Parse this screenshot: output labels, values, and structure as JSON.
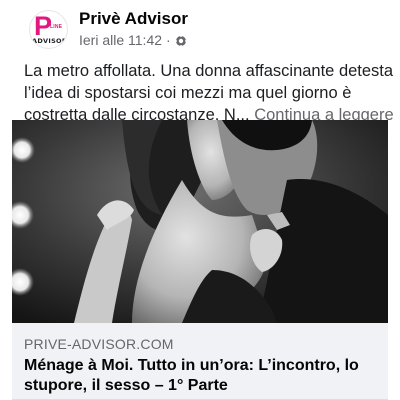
{
  "post": {
    "page_name": "Privè Advisor",
    "timestamp": "Ieri alle 11:42",
    "separator": "·",
    "audience_icon": "globe-icon",
    "text": "La metro affollata. Una donna affascinante detesta l’idea di spostarsi coi mezzi ma quel giorno è costretta dalle circostanze. N...",
    "see_more": "Continua a leggere"
  },
  "avatar": {
    "logo_letter": "P",
    "logo_small": "LINE",
    "logo_text": "ADVISOR"
  },
  "link": {
    "domain": "PRIVE-ADVISOR.COM",
    "title": "Ménage à Moi. Tutto in un’ora: L’incontro, lo stupore, il sesso – 1° Parte"
  },
  "colors": {
    "brand_pink": "#e2177f",
    "text_primary": "#1c1e21",
    "text_secondary": "#65676b",
    "preview_bg": "#f0f2f5"
  }
}
